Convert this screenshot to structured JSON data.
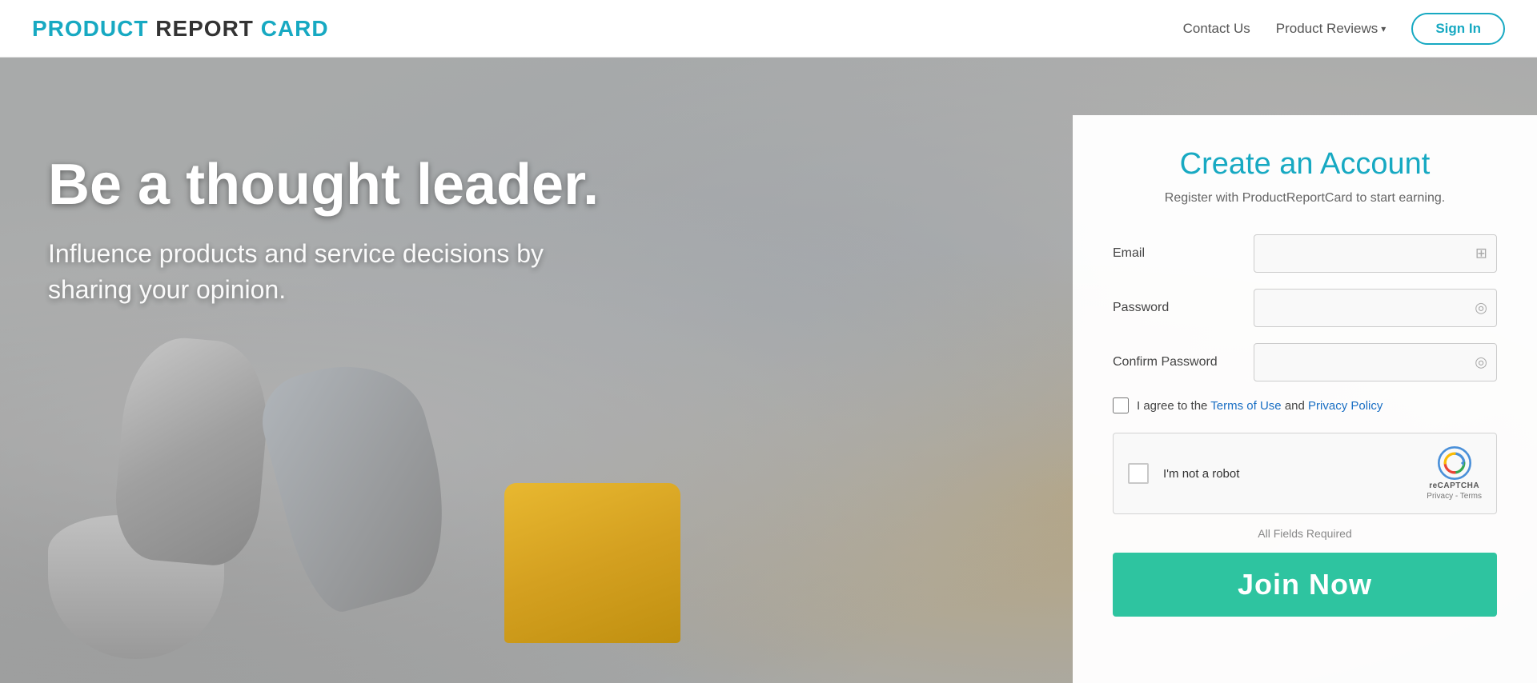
{
  "navbar": {
    "logo": {
      "product": "PRODUCT",
      "report": " REPORT",
      "card": " CARD"
    },
    "nav_links": [
      {
        "id": "contact",
        "label": "Contact Us"
      },
      {
        "id": "reviews",
        "label": "Product Reviews",
        "hasDropdown": true
      }
    ],
    "sign_in_label": "Sign In"
  },
  "hero": {
    "headline": "Be a thought leader.",
    "subtext": "Influence products and service decisions by sharing your opinion."
  },
  "form": {
    "title": "Create an Account",
    "subtitle": "Register with ProductReportCard to start earning.",
    "fields": [
      {
        "id": "email",
        "label": "Email",
        "type": "email",
        "placeholder": "",
        "icon": "📋"
      },
      {
        "id": "password",
        "label": "Password",
        "type": "password",
        "placeholder": "",
        "icon": "👁"
      },
      {
        "id": "confirm_password",
        "label": "Confirm Password",
        "type": "password",
        "placeholder": "",
        "icon": "👁"
      }
    ],
    "agree_prefix": "I agree to the ",
    "terms_label": "Terms of Use",
    "and_text": " and ",
    "privacy_label": "Privacy Policy",
    "captcha_text": "I'm not a robot",
    "captcha_brand": "reCAPTCHA",
    "captcha_links": "Privacy - Terms",
    "all_fields_label": "All Fields Required",
    "join_btn_label": "Join Now"
  }
}
